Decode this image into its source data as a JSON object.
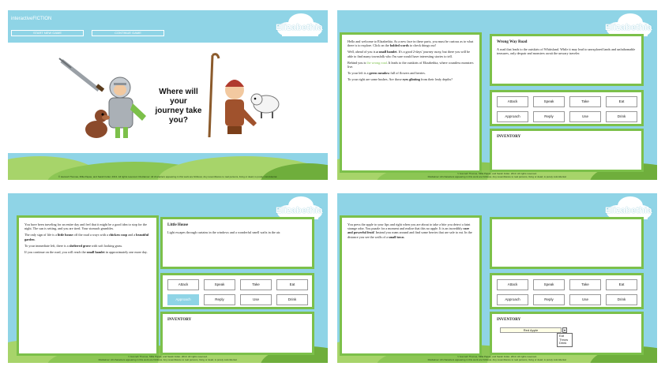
{
  "splash": {
    "brand": "interactiveFICTION",
    "start_label": "START NEW GAME",
    "continue_label": "CONTINUE GAME",
    "tagline": "Where will your journey take you?",
    "footer": "© Hannah Thomas, Milla Papas, and Sarah Follet. 2013. All rights reserved. Disclaimer: All characters appearing in this work are fictitious. Any resemblance to real persons, living or dead, is purely coincidental."
  },
  "game_title": "Elizabethia",
  "footer_line1": "© Hannah Thomas, Milla Papas, and Sarah Follet. 2013. All rights reserved.",
  "footer_line2": "Disclaimer: All characters appearing in this work are fictitious. Any resemblance to real persons, living or dead, is purely coincidental.",
  "actions": [
    "Attack",
    "Speak",
    "Take",
    "Eat",
    "Approach",
    "Reply",
    "Use",
    "Drink"
  ],
  "inventory_label": "INVENTORY",
  "screen2": {
    "story": [
      {
        "parts": [
          {
            "t": "Hello and welcome to Elizabethia. As a new face in these parts, you must be curious as to what there is to explore. Click on the "
          },
          {
            "t": "bolded words",
            "s": "b"
          },
          {
            "t": " to check things out!"
          }
        ]
      },
      {
        "parts": [
          {
            "t": "Well, ahead of you is "
          },
          {
            "t": "a small hamlet",
            "s": "b"
          },
          {
            "t": ". It's a good 2-days' journey away, but there you will be able to find many townsfolk who I'm sure would have interesting stories to tell."
          }
        ]
      },
      {
        "parts": [
          {
            "t": "Behind you is "
          },
          {
            "t": "the wrong road",
            "s": "g"
          },
          {
            "t": ". It leads to the outskirts of Elizabethia, where countless monsters live."
          }
        ]
      },
      {
        "parts": [
          {
            "t": "To your left is a "
          },
          {
            "t": "green meadow",
            "s": "b"
          },
          {
            "t": " full of flowers and berries."
          }
        ]
      },
      {
        "parts": [
          {
            "t": "To your right are some bushes. Are those "
          },
          {
            "t": "eyes glinting",
            "s": "b"
          },
          {
            "t": " from their leafy depths?"
          }
        ]
      }
    ],
    "location_title": "Wrong Way Road",
    "location_text": "A road that leads to the outskirts of Whittsland. While it may lead to unexplored lands and unfathomable treasures, only despair and monsters await the unwary traveler."
  },
  "screen3": {
    "story": [
      {
        "parts": [
          {
            "t": "You have been traveling for an entire day and feel that it might be a good idea to stop for the night. The sun is setting, and you are tired. Your stomach grumbles."
          }
        ]
      },
      {
        "parts": [
          {
            "t": "The only sign of life is a "
          },
          {
            "t": "little house",
            "s": "b"
          },
          {
            "t": " off the road a ways with a "
          },
          {
            "t": "chicken coop",
            "s": "b"
          },
          {
            "t": " and a "
          },
          {
            "t": "beautiful garden",
            "s": "b"
          },
          {
            "t": "."
          }
        ]
      },
      {
        "parts": [
          {
            "t": "To your immediate left, there is a "
          },
          {
            "t": "sheltered grove",
            "s": "b"
          },
          {
            "t": " with soft looking grass."
          }
        ]
      },
      {
        "parts": [
          {
            "t": "If you continue on the road, you will reach the "
          },
          {
            "t": "small hamlet",
            "s": "b"
          },
          {
            "t": " in approximately one more day."
          }
        ]
      }
    ],
    "location_title": "Little House",
    "location_text": "Light escapes through curtains in the windows and a wonderful smell wafts in the air.",
    "active_action": "Approach"
  },
  "screen4": {
    "story": [
      {
        "parts": [
          {
            "t": "You press the apple to your lips and right when you are about to take a bite you detect a faint strange odor. You puzzle for a moment and realize that this no apple. It is an incredibly "
          },
          {
            "t": "rare and powerful fruit!",
            "s": "b"
          },
          {
            "t": " Instead you roam around and find some berries that are safe to eat. In the distance you see the walls of a "
          },
          {
            "t": "small town",
            "s": "b"
          },
          {
            "t": "."
          }
        ]
      }
    ],
    "inventory_item": "Red Apple",
    "inventory_options": [
      "Eat",
      "Throw",
      "Drink"
    ]
  },
  "colors": {
    "sky": "#8fd4e6",
    "border_green": "#7cc04a",
    "hill_light": "#a7d46a",
    "hill_dark": "#6fae3c",
    "active_action": "#8fd4e6"
  }
}
